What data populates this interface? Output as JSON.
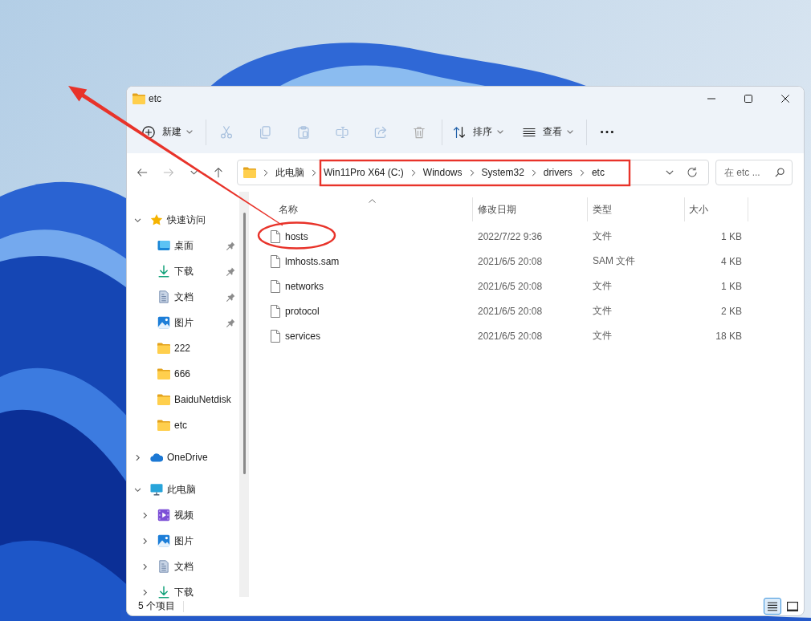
{
  "window": {
    "title": "etc",
    "controls": [
      {
        "kind": "minimize"
      },
      {
        "kind": "maximize"
      },
      {
        "kind": "close"
      }
    ]
  },
  "toolbar": {
    "groups": [
      [
        {
          "kind": "new",
          "label": "新建",
          "dropdown": true,
          "disabled": false
        }
      ],
      [
        {
          "kind": "cut",
          "dropdown": false,
          "disabled": true
        },
        {
          "kind": "copy",
          "dropdown": false,
          "disabled": true
        },
        {
          "kind": "paste",
          "dropdown": false,
          "disabled": true
        },
        {
          "kind": "rename",
          "dropdown": false,
          "disabled": true
        },
        {
          "kind": "share",
          "dropdown": false,
          "disabled": true
        },
        {
          "kind": "delete",
          "dropdown": false,
          "disabled": true
        }
      ],
      [
        {
          "kind": "sort",
          "label": "排序",
          "dropdown": true,
          "disabled": false
        },
        {
          "kind": "view",
          "label": "查看",
          "dropdown": true,
          "disabled": false
        }
      ],
      [
        {
          "kind": "more",
          "dropdown": false,
          "disabled": false
        }
      ]
    ]
  },
  "navigation": [
    {
      "kind": "back",
      "disabled": false
    },
    {
      "kind": "forward",
      "disabled": true
    },
    {
      "kind": "recent",
      "disabled": false
    },
    {
      "kind": "up",
      "disabled": false
    }
  ],
  "address_bar": {
    "breadcrumbs": [
      "此电脑",
      "Win11Pro X64 (C:)",
      "Windows",
      "System32",
      "drivers",
      "etc"
    ]
  },
  "search": {
    "placeholder": "在 etc ..."
  },
  "sidebar": {
    "items": [
      {
        "label": "快速访问",
        "kind": "star",
        "expanded": true,
        "selected": false,
        "children": [
          {
            "label": "桌面",
            "kind": "desktop",
            "pinned": true,
            "selected": false
          },
          {
            "label": "下载",
            "kind": "downloads",
            "pinned": true,
            "selected": false
          },
          {
            "label": "文档",
            "kind": "documents",
            "pinned": true,
            "selected": false
          },
          {
            "label": "图片",
            "kind": "pictures",
            "pinned": true,
            "selected": false
          },
          {
            "label": "222",
            "kind": "folder",
            "pinned": false,
            "selected": false
          },
          {
            "label": "666",
            "kind": "folder",
            "pinned": false,
            "selected": false
          },
          {
            "label": "BaiduNetdisk",
            "kind": "folder",
            "pinned": false,
            "selected": false
          },
          {
            "label": "etc",
            "kind": "folder",
            "pinned": false,
            "selected": false
          }
        ]
      },
      {
        "label": "OneDrive",
        "kind": "cloud",
        "expanded": false,
        "selected": false
      },
      {
        "label": "此电脑",
        "kind": "computer",
        "expanded": true,
        "selected": false,
        "children": [
          {
            "label": "视频",
            "kind": "videos",
            "expanded": false,
            "selected": false
          },
          {
            "label": "图片",
            "kind": "pictures",
            "expanded": false,
            "selected": false
          },
          {
            "label": "文档",
            "kind": "documents",
            "expanded": false,
            "selected": false
          },
          {
            "label": "下载",
            "kind": "downloads",
            "expanded": false,
            "selected": false
          }
        ]
      }
    ]
  },
  "file_list": {
    "columns": [
      {
        "label": "名称",
        "sorted": true
      },
      {
        "label": "修改日期",
        "sorted": false
      },
      {
        "label": "类型",
        "sorted": false
      },
      {
        "label": "大小",
        "sorted": false
      }
    ],
    "rows": [
      {
        "name": "hosts",
        "modified": "2022/7/22 9:36",
        "type": "文件",
        "size": "1 KB",
        "selected": false
      },
      {
        "name": "lmhosts.sam",
        "modified": "2021/6/5 20:08",
        "type": "SAM 文件",
        "size": "4 KB",
        "selected": false
      },
      {
        "name": "networks",
        "modified": "2021/6/5 20:08",
        "type": "文件",
        "size": "1 KB",
        "selected": false
      },
      {
        "name": "protocol",
        "modified": "2021/6/5 20:08",
        "type": "文件",
        "size": "2 KB",
        "selected": false
      },
      {
        "name": "services",
        "modified": "2021/6/5 20:08",
        "type": "文件",
        "size": "18 KB",
        "selected": false
      }
    ]
  },
  "status_bar": {
    "item_count": "5 个项目",
    "views": [
      {
        "kind": "details",
        "selected": true
      },
      {
        "kind": "tiles",
        "selected": false
      }
    ]
  },
  "annotations": [
    {
      "kind": "arrow"
    },
    {
      "kind": "ellipse"
    },
    {
      "kind": "rectangle"
    }
  ]
}
